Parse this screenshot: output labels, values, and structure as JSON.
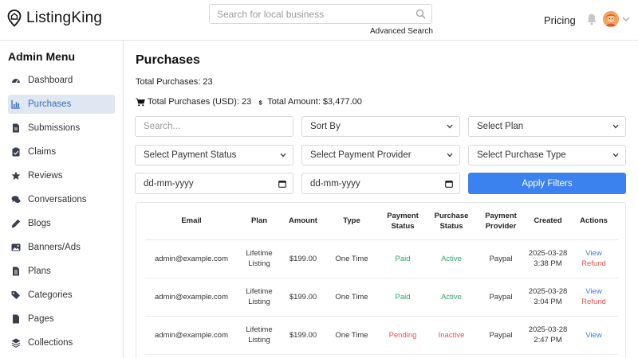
{
  "header": {
    "logo_text": "ListingKing",
    "search_placeholder": "Search for local business",
    "advanced_search": "Advanced Search",
    "pricing": "Pricing"
  },
  "sidebar": {
    "title": "Admin Menu",
    "items": [
      {
        "label": "Dashboard",
        "icon": "dashboard-icon"
      },
      {
        "label": "Purchases",
        "icon": "chart-icon",
        "active": true
      },
      {
        "label": "Submissions",
        "icon": "file-icon"
      },
      {
        "label": "Claims",
        "icon": "clipboard-check-icon"
      },
      {
        "label": "Reviews",
        "icon": "star-icon"
      },
      {
        "label": "Conversations",
        "icon": "comments-icon"
      },
      {
        "label": "Blogs",
        "icon": "pencil-icon"
      },
      {
        "label": "Banners/Ads",
        "icon": "image-icon"
      },
      {
        "label": "Plans",
        "icon": "list-icon"
      },
      {
        "label": "Categories",
        "icon": "tags-icon"
      },
      {
        "label": "Pages",
        "icon": "file-icon"
      },
      {
        "label": "Collections",
        "icon": "layers-icon"
      }
    ]
  },
  "main": {
    "title": "Purchases",
    "total_purchases": "Total Purchases: 23",
    "total_usd": "Total Purchases (USD): 23",
    "total_amount": "Total Amount: $3,477.00",
    "filters": {
      "search_placeholder": "Search...",
      "sort_by": "Sort By",
      "select_plan": "Select Plan",
      "payment_status": "Select Payment Status",
      "payment_provider": "Select Payment Provider",
      "purchase_type": "Select Purchase Type",
      "date_from": "dd-mm-yyyy",
      "date_to": "dd-mm-yyyy",
      "apply": "Apply Filters"
    },
    "table": {
      "headers": [
        "Email",
        "Plan",
        "Amount",
        "Type",
        "Payment Status",
        "Purchase Status",
        "Payment Provider",
        "Created",
        "Actions"
      ],
      "rows": [
        {
          "email": "admin@example.com",
          "plan": "Lifetime Listing",
          "amount": "$199.00",
          "type": "One Time",
          "payment_status": "Paid",
          "purchase_status": "Active",
          "provider": "Paypal",
          "created_date": "2025-03-28",
          "created_time": "3:38 PM",
          "view": "View",
          "refund": "Refund"
        },
        {
          "email": "admin@example.com",
          "plan": "Lifetime Listing",
          "amount": "$199.00",
          "type": "One Time",
          "payment_status": "Paid",
          "purchase_status": "Active",
          "provider": "Paypal",
          "created_date": "2025-03-28",
          "created_time": "3:04 PM",
          "view": "View",
          "refund": "Refund"
        },
        {
          "email": "admin@example.com",
          "plan": "Lifetime Listing",
          "amount": "$199.00",
          "type": "One Time",
          "payment_status": "Pending",
          "purchase_status": "Inactive",
          "provider": "Paypal",
          "created_date": "2025-03-28",
          "created_time": "2:47 PM",
          "view": "View",
          "refund": ""
        }
      ]
    }
  },
  "colors": {
    "accent": "#3b82f0",
    "active_bg": "#dfe7f3",
    "success": "#2aa86a",
    "danger": "#e05454",
    "link": "#3b7be0"
  }
}
